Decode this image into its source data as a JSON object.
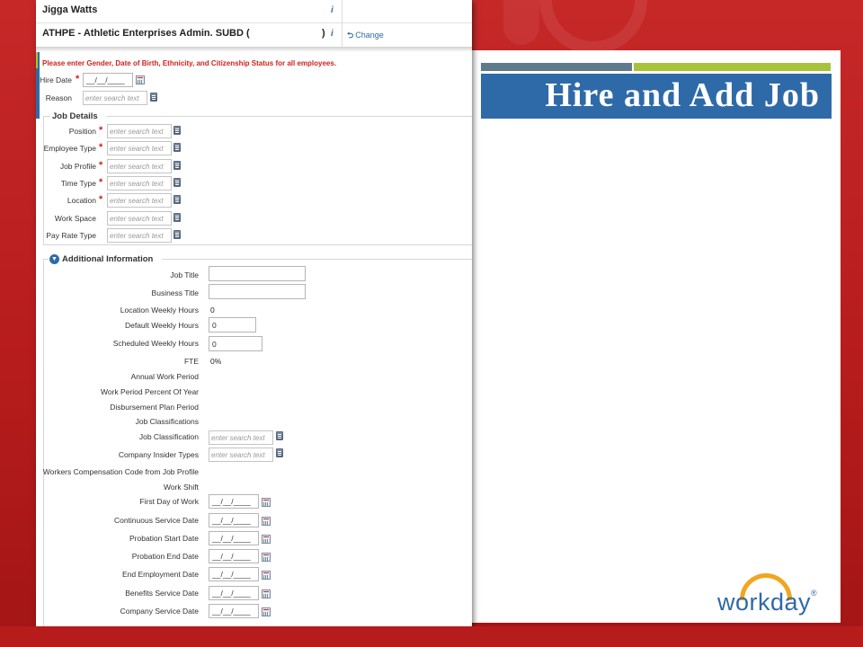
{
  "slide": {
    "title": "Hire and Add Job",
    "logo_text": "workday",
    "logo_mark": "®",
    "accent_colors": {
      "red": "#b71c1c",
      "blue": "#2f6aa8",
      "lime": "#a8c23a",
      "gray": "#5f7a8a",
      "orange": "#f2a51e",
      "required": "#d0211d"
    }
  },
  "header": {
    "employee_name": "Jigga Watts",
    "org_text": "ATHPE - Athletic Enterprises Admin. SUBD (",
    "org_close": ")",
    "info_icon": "i",
    "change_icon": "⮌",
    "change_label": "Change"
  },
  "warning": "Please enter Gender, Date of Birth, Ethnicity, and Citizenship Status for all employees.",
  "top_fields": {
    "hire_date_label": "Hire Date",
    "hire_date_value": "__/__/____",
    "reason_label": "Reason",
    "search_placeholder": "enter search text"
  },
  "job_details": {
    "title": "Job Details",
    "fields": [
      {
        "label": "Position",
        "required": true
      },
      {
        "label": "Employee Type",
        "required": true
      },
      {
        "label": "Job Profile",
        "required": true
      },
      {
        "label": "Time Type",
        "required": true
      },
      {
        "label": "Location",
        "required": true
      },
      {
        "label": "Work Space",
        "required": false
      },
      {
        "label": "Pay Rate Type",
        "required": false
      }
    ],
    "required_mark": "*"
  },
  "additional": {
    "toggle_icon": "▼",
    "title": "Additional Information",
    "job_title_label": "Job Title",
    "business_title_label": "Business Title",
    "location_weekly_hours_label": "Location Weekly Hours",
    "location_weekly_hours_value": "0",
    "default_weekly_hours_label": "Default Weekly Hours",
    "default_weekly_hours_value": "0",
    "scheduled_weekly_hours_label": "Scheduled Weekly Hours",
    "scheduled_weekly_hours_value": "0",
    "fte_label": "FTE",
    "fte_value": "0%",
    "annual_work_period_label": "Annual Work Period",
    "work_period_percent_label": "Work Period Percent Of Year",
    "disbursement_plan_label": "Disbursement Plan Period",
    "job_classifications_label": "Job Classifications",
    "job_classification_label": "Job Classification",
    "company_insider_label": "Company Insider Types",
    "workers_comp_label": "Workers Compensation Code from Job Profile",
    "work_shift_label": "Work Shift",
    "search_placeholder": "enter search text",
    "date_placeholder": "__/__/____",
    "date_fields": [
      "First Day of Work",
      "Continuous Service Date",
      "Probation Start Date",
      "Probation End Date",
      "End Employment Date",
      "Benefits Service Date",
      "Company Service Date"
    ]
  }
}
